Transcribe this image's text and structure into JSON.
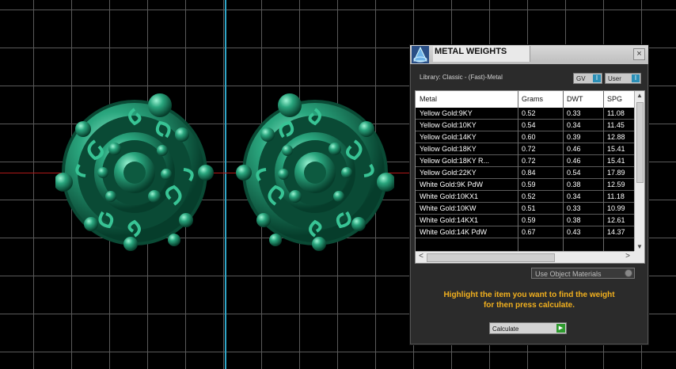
{
  "panel": {
    "title": "METAL WEIGHTS",
    "close_glyph": "×",
    "library_label": "Library: Classic - (Fast)-Metal",
    "toggles": [
      {
        "label": "GV",
        "icon": "toggle-icon"
      },
      {
        "label": "User",
        "icon": "toggle-icon"
      }
    ],
    "table": {
      "headers": [
        "Metal",
        "Grams",
        "DWT",
        "SPG"
      ],
      "rows": [
        [
          "Yellow Gold:9KY",
          "0.52",
          "0.33",
          "11.08"
        ],
        [
          "Yellow Gold:10KY",
          "0.54",
          "0.34",
          "11.45"
        ],
        [
          "Yellow Gold:14KY",
          "0.60",
          "0.39",
          "12.88"
        ],
        [
          "Yellow Gold:18KY",
          "0.72",
          "0.46",
          "15.41"
        ],
        [
          "Yellow Gold:18KY R...",
          "0.72",
          "0.46",
          "15.41"
        ],
        [
          "Yellow Gold:22KY",
          "0.84",
          "0.54",
          "17.89"
        ],
        [
          "White Gold:9K PdW",
          "0.59",
          "0.38",
          "12.59"
        ],
        [
          "White Gold:10KX1",
          "0.52",
          "0.34",
          "11.18"
        ],
        [
          "White Gold:10KW",
          "0.51",
          "0.33",
          "10.99"
        ],
        [
          "White Gold:14KX1",
          "0.59",
          "0.38",
          "12.61"
        ],
        [
          "White Gold:14K PdW",
          "0.67",
          "0.43",
          "14.37"
        ]
      ]
    },
    "use_object_materials": "Use Object Materials",
    "hint_line1": "Highlight the item you want to find the weight",
    "hint_line2": "for then press calculate.",
    "calculate_label": "Calculate",
    "scroll": {
      "left": "<",
      "right": ">",
      "up": "▲",
      "down": "▼"
    }
  },
  "colors": {
    "accent": "#2b8fb6",
    "hint": "#f2b01e",
    "model": "#1f8f6a",
    "axis_y": "#2fa6c8",
    "axis_x": "#b01818"
  }
}
